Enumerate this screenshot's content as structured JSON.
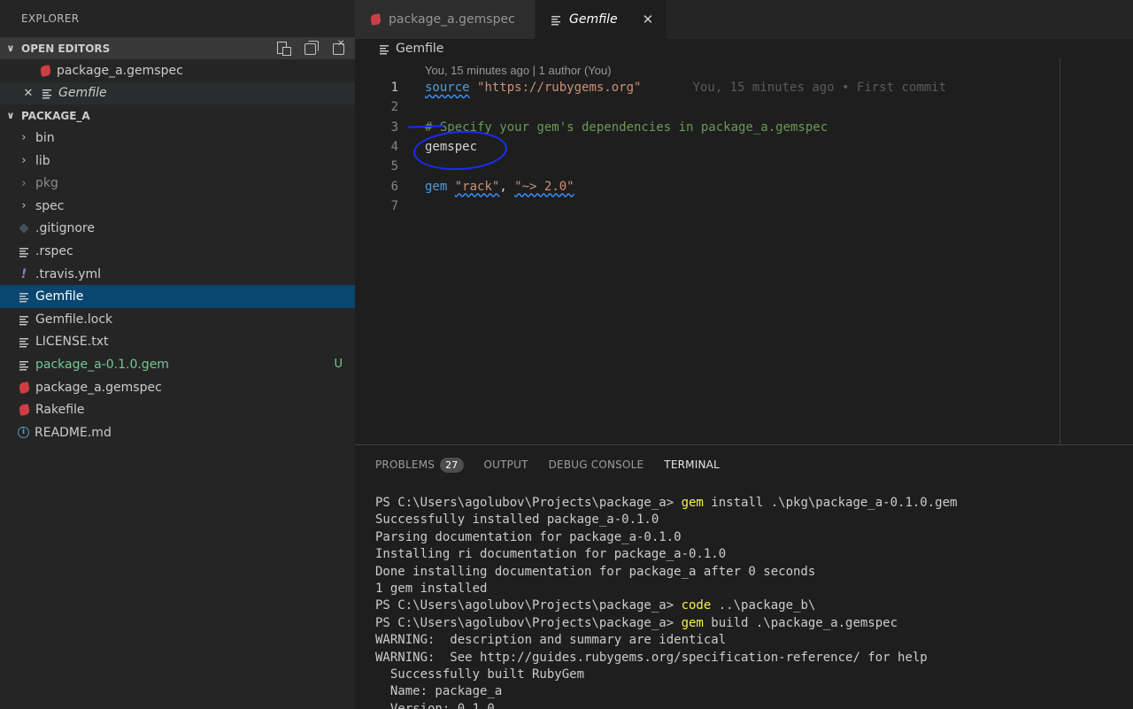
{
  "sidebar": {
    "title": "EXPLORER",
    "open_editors": {
      "label": "OPEN EDITORS",
      "items": [
        {
          "label": "package_a.gemspec",
          "icon": "ruby-icon"
        },
        {
          "label": "Gemfile",
          "icon": "lines-file-icon"
        }
      ]
    },
    "project": {
      "label": "PACKAGE_A",
      "items": [
        {
          "label": "bin"
        },
        {
          "label": "lib"
        },
        {
          "label": "pkg"
        },
        {
          "label": "spec"
        },
        {
          "label": ".gitignore"
        },
        {
          "label": ".rspec"
        },
        {
          "label": ".travis.yml"
        },
        {
          "label": "Gemfile"
        },
        {
          "label": "Gemfile.lock"
        },
        {
          "label": "LICENSE.txt"
        },
        {
          "label": "package_a-0.1.0.gem",
          "badge": "U"
        },
        {
          "label": "package_a.gemspec"
        },
        {
          "label": "Rakefile"
        },
        {
          "label": "README.md"
        }
      ]
    }
  },
  "tabs": [
    {
      "label": "package_a.gemspec"
    },
    {
      "label": "Gemfile",
      "close": "✕"
    }
  ],
  "breadcrumb": {
    "label": "Gemfile"
  },
  "editor": {
    "codelens": "You, 15 minutes ago | 1 author (You)",
    "lines": [
      {
        "num": "1",
        "kw": "source",
        "str": "\"https://rubygems.org\"",
        "blame": "You, 15 minutes ago • First commit"
      },
      {
        "num": "2"
      },
      {
        "num": "3",
        "comment": "# Specify your gem's dependencies in package_a.gemspec"
      },
      {
        "num": "4",
        "plain": "gemspec"
      },
      {
        "num": "5"
      },
      {
        "num": "6",
        "kw": "gem",
        "str1": "\"rack\"",
        "sep": ", ",
        "str2": "\"~> 2.0\""
      },
      {
        "num": "7"
      }
    ]
  },
  "panel": {
    "tabs": [
      {
        "label": "PROBLEMS",
        "count": "27"
      },
      {
        "label": "OUTPUT"
      },
      {
        "label": "DEBUG CONSOLE"
      },
      {
        "label": "TERMINAL"
      }
    ],
    "terminal": [
      {
        "prompt": "PS C:\\Users\\agolubov\\Projects\\package_a> ",
        "cmd": "gem",
        "rest": " install .\\pkg\\package_a-0.1.0.gem"
      },
      {
        "text": "Successfully installed package_a-0.1.0"
      },
      {
        "text": "Parsing documentation for package_a-0.1.0"
      },
      {
        "text": "Installing ri documentation for package_a-0.1.0"
      },
      {
        "text": "Done installing documentation for package_a after 0 seconds"
      },
      {
        "text": "1 gem installed"
      },
      {
        "prompt": "PS C:\\Users\\agolubov\\Projects\\package_a> ",
        "cmd": "code",
        "rest": " ..\\package_b\\"
      },
      {
        "prompt": "PS C:\\Users\\agolubov\\Projects\\package_a> ",
        "cmd": "gem",
        "rest": " build .\\package_a.gemspec"
      },
      {
        "text": "WARNING:  description and summary are identical"
      },
      {
        "text": "WARNING:  See http://guides.rubygems.org/specification-reference/ for help"
      },
      {
        "text": "  Successfully built RubyGem"
      },
      {
        "text": "  Name: package_a"
      },
      {
        "text": "  Version: 0.1.0"
      }
    ]
  }
}
